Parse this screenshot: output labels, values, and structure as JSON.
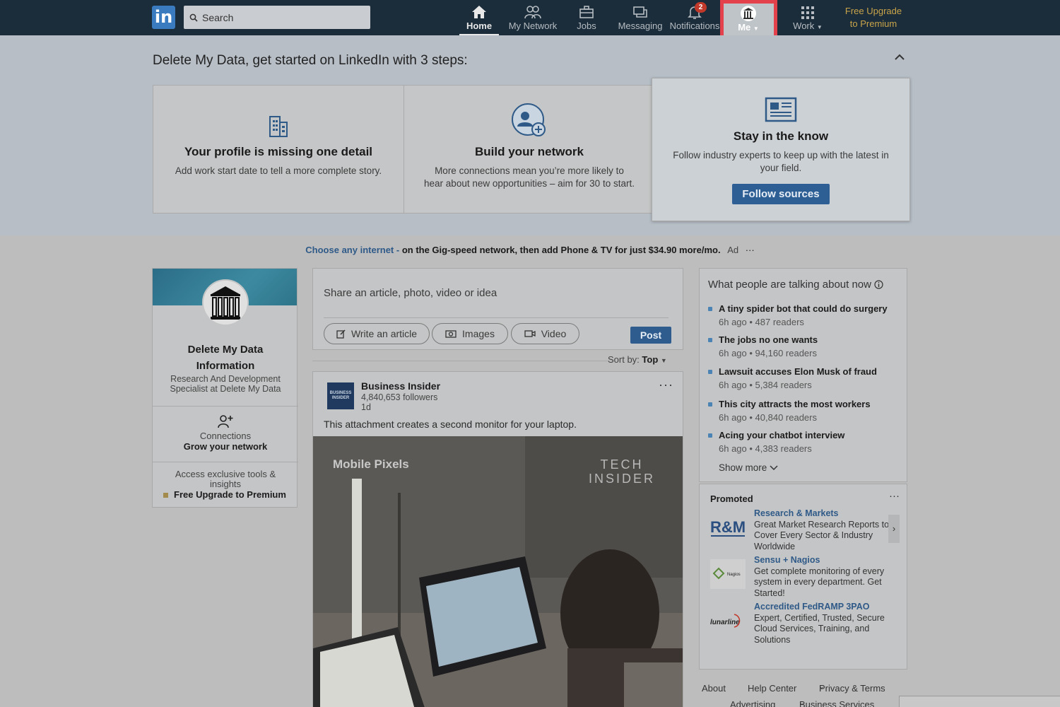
{
  "nav": {
    "logo": "in",
    "search_placeholder": "Search",
    "items": [
      {
        "label": "Home",
        "icon": "home-icon"
      },
      {
        "label": "My Network",
        "icon": "people-icon"
      },
      {
        "label": "Jobs",
        "icon": "briefcase-icon"
      },
      {
        "label": "Messaging",
        "icon": "messaging-icon"
      },
      {
        "label": "Notifications",
        "icon": "bell-icon",
        "badge": "2"
      }
    ],
    "me_label": "Me",
    "work_label": "Work",
    "premium_line1": "Free Upgrade",
    "premium_line2": "to Premium"
  },
  "onboarding": {
    "title": "Delete My Data, get started on LinkedIn with 3 steps:",
    "cards": [
      {
        "title": "Your profile is missing one detail",
        "text": "Add work start date to tell a more complete story."
      },
      {
        "title": "Build your network",
        "text": "More connections mean you’re more likely to hear about new opportunities – aim for 30 to start."
      },
      {
        "title": "Stay in the know",
        "text": "Follow industry experts to keep up with the latest in your field.",
        "button": "Follow sources"
      }
    ]
  },
  "ad": {
    "link": "Choose any internet -",
    "text": "on the Gig-speed network, then add Phone & TV for just $34.90 more/mo.",
    "tag": "Ad",
    "menu": "···"
  },
  "profile": {
    "name": "Delete My Data Information",
    "title": "Research And Development Specialist at Delete My Data",
    "connections_label": "Connections",
    "connections_cta": "Grow your network",
    "access_text": "Access exclusive tools & insights",
    "upgrade": "Free Upgrade to Premium"
  },
  "share": {
    "prompt": "Share an article, photo, video or idea",
    "write_article": "Write an article",
    "images": "Images",
    "video": "Video",
    "post": "Post"
  },
  "sort": {
    "label": "Sort by:",
    "value": "Top"
  },
  "post": {
    "logo_text": "BUSINESS INSIDER",
    "author": "Business Insider",
    "followers": "4,840,653 followers",
    "time": "1d",
    "menu": "···",
    "text": "This attachment creates a second monitor for your laptop.",
    "media_left": "Mobile Pixels",
    "media_right_1": "TECH",
    "media_right_2": "INSIDER"
  },
  "trending": {
    "title": "What people are talking about now",
    "items": [
      {
        "title": "A tiny spider bot that could do surgery",
        "meta": "6h ago • 487 readers"
      },
      {
        "title": "The jobs no one wants",
        "meta": "6h ago • 94,160 readers"
      },
      {
        "title": "Lawsuit accuses Elon Musk of fraud",
        "meta": "6h ago • 5,384 readers"
      },
      {
        "title": "This city attracts the most workers",
        "meta": "6h ago • 40,840 readers"
      },
      {
        "title": "Acing your chatbot interview",
        "meta": "6h ago • 4,383 readers"
      }
    ],
    "show_more": "Show more"
  },
  "promoted": {
    "title": "Promoted",
    "menu": "···",
    "items": [
      {
        "name": "Research & Markets",
        "text": "Great Market Research Reports to Cover Every Sector & Industry Worldwide",
        "logo": "R&M"
      },
      {
        "name": "Sensu + Nagios",
        "text": "Get complete monitoring of every system in every department. Get Started!",
        "logo": "Nagios"
      },
      {
        "name": "Accredited FedRAMP 3PAO",
        "text": "Expert, Certified, Trusted, Secure Cloud Services, Training, and Solutions",
        "logo": "lunarline"
      }
    ]
  },
  "footer": {
    "about": "About",
    "help": "Help Center",
    "privacy": "Privacy & Terms",
    "advertising": "Advertising",
    "business": "Business Services"
  }
}
